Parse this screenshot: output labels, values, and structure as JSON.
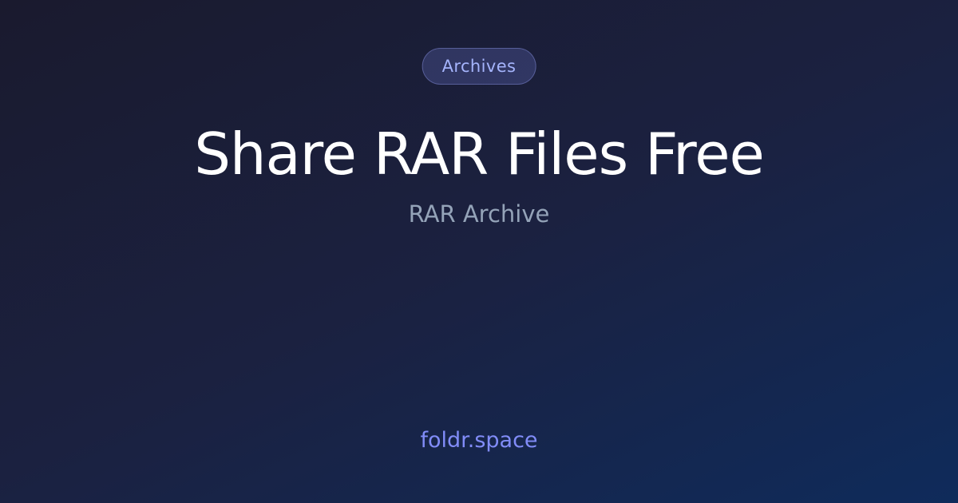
{
  "badge": {
    "label": "Archives"
  },
  "title": "Share RAR Files Free",
  "subtitle": "RAR Archive",
  "site": {
    "domain": "foldr.space"
  },
  "colors": {
    "background_start": "#1a1a2e",
    "background_end": "#0f2b5b",
    "title": "#ffffff",
    "subtitle": "#94a3b8",
    "accent": "#818cf8",
    "badge_text": "#a5b4fc"
  }
}
